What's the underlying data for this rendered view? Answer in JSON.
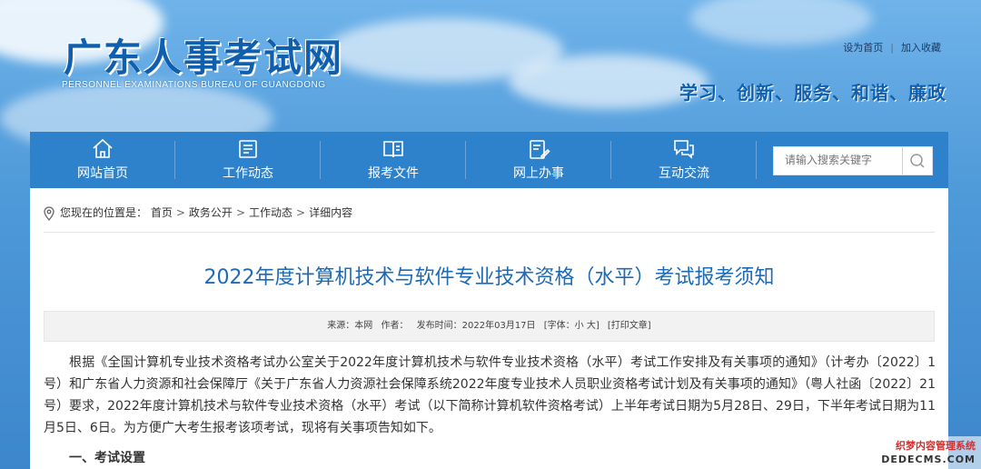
{
  "site": {
    "title": "广东人事考试网",
    "subtitle": "PERSONNEL EXAMINATIONS BUREAU OF GUANGDONG",
    "slogan": "学习、创新、服务、和谐、廉政",
    "links": {
      "homepage": "设为首页",
      "separator": "|",
      "favorite": "加入收藏"
    }
  },
  "nav": {
    "items": [
      {
        "label": "网站首页",
        "icon": "home-icon"
      },
      {
        "label": "工作动态",
        "icon": "news-icon"
      },
      {
        "label": "报考文件",
        "icon": "book-icon"
      },
      {
        "label": "网上办事",
        "icon": "edit-doc-icon"
      },
      {
        "label": "互动交流",
        "icon": "chat-icon"
      }
    ],
    "search": {
      "placeholder": "请输入搜索关键字",
      "icon": "search-icon"
    }
  },
  "breadcrumb": {
    "prefix": "您现在的位置是：",
    "items": [
      "首页",
      "政务公开",
      "工作动态",
      "详细内容"
    ],
    "separator": ">"
  },
  "article": {
    "title": "2022年度计算机技术与软件专业技术资格（水平）考试报考须知",
    "meta": {
      "source": "来源：本网",
      "author": "作者：",
      "date": "发布时间：2022年03月17日",
      "font": "[字体：小 大]",
      "print": "[打印文章]"
    },
    "paragraph": "根据《全国计算机专业技术资格考试办公室关于2022年度计算机技术与软件专业技术资格（水平）考试工作安排及有关事项的通知》（计考办〔2022〕1号）和广东省人力资源和社会保障厅《关于广东省人力资源社会保障系统2022年度专业技术人员职业资格考试计划及有关事项的通知》（粤人社函〔2022〕21号）要求，2022年度计算机技术与软件专业技术资格（水平）考试（以下简称计算机软件资格考试）上半年考试日期为5月28日、29日，下半年考试日期为11月5日、6日。为方便广大考生报考该项考试，现将有关事项告知如下。",
    "section1": "一、考试设置"
  },
  "watermark": {
    "line1": "织梦内容管理系统",
    "line2": "DEDECMS.COM"
  },
  "colors": {
    "nav": "#2e81cb",
    "title": "#1d6ab5",
    "brand": "#0f5fae"
  }
}
